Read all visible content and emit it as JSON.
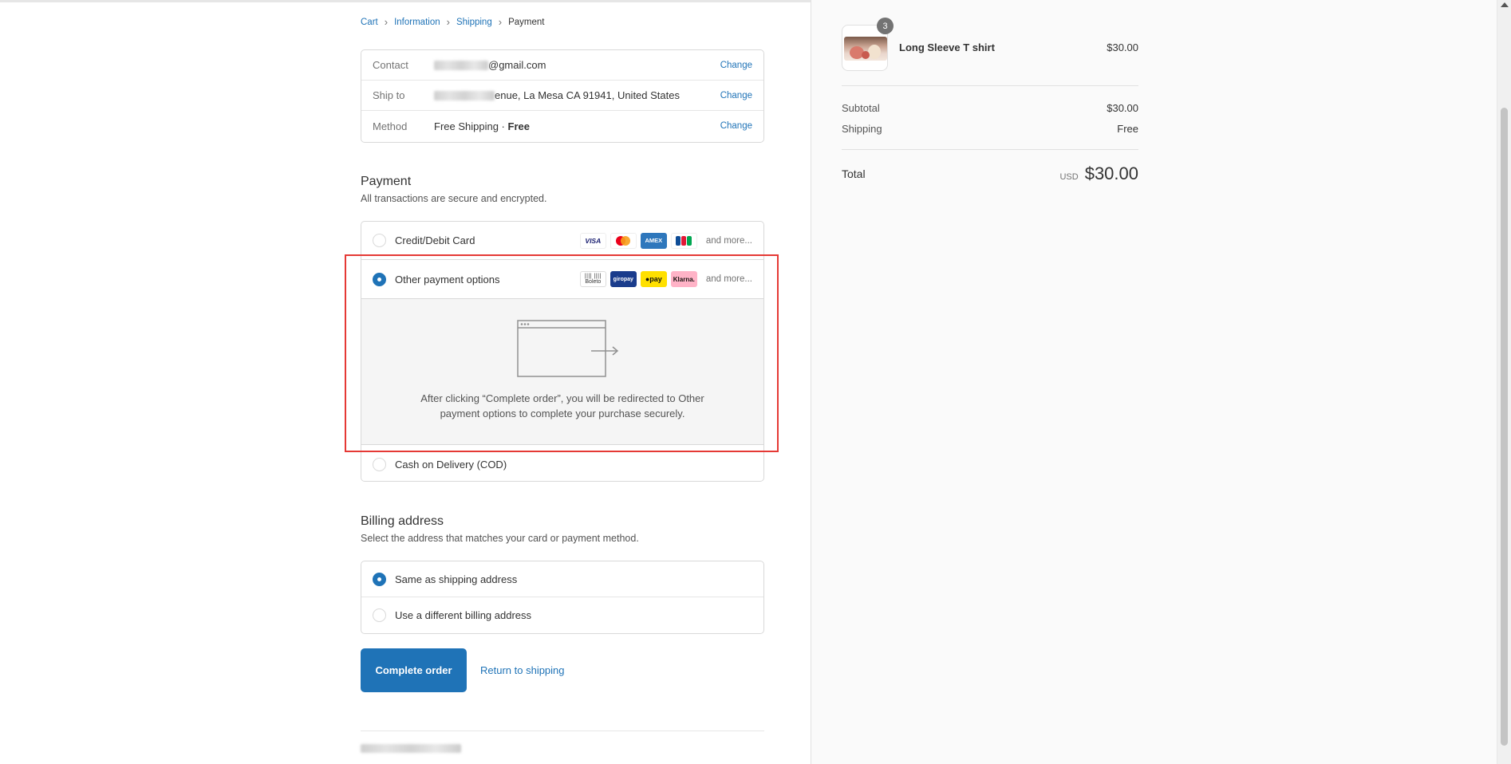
{
  "breadcrumb": {
    "items": [
      {
        "label": "Cart"
      },
      {
        "label": "Information"
      },
      {
        "label": "Shipping"
      },
      {
        "label": "Payment"
      }
    ]
  },
  "review": {
    "contact": {
      "label": "Contact",
      "value_visible": "@gmail.com",
      "change": "Change"
    },
    "ship_to": {
      "label": "Ship to",
      "value_visible": "enue, La Mesa CA 91941, United States",
      "change": "Change"
    },
    "method": {
      "label": "Method",
      "value_prefix": "Free Shipping · ",
      "value_bold": "Free",
      "change": "Change"
    }
  },
  "payment": {
    "title": "Payment",
    "subtitle": "All transactions are secure and encrypted.",
    "options": [
      {
        "label": "Credit/Debit Card",
        "selected": false,
        "icons": [
          "VISA",
          "mastercard",
          "AMEX",
          "JCB"
        ],
        "more": "and more..."
      },
      {
        "label": "Other payment options",
        "selected": true,
        "icons": [
          "Boleto",
          "giropay",
          "pay",
          "Klarna."
        ],
        "more": "and more..."
      },
      {
        "label": "Cash on Delivery (COD)",
        "selected": false
      }
    ],
    "redirect_text": "After clicking “Complete order”, you will be redirected to Other payment options to complete your purchase securely."
  },
  "billing": {
    "title": "Billing address",
    "subtitle": "Select the address that matches your card or payment method.",
    "options": [
      {
        "label": "Same as shipping address",
        "selected": true
      },
      {
        "label": "Use a different billing address",
        "selected": false
      }
    ]
  },
  "actions": {
    "complete": "Complete order",
    "return": "Return to shipping"
  },
  "summary": {
    "product": {
      "name": "Long Sleeve T shirt",
      "price": "$30.00",
      "quantity": "3"
    },
    "subtotal_label": "Subtotal",
    "subtotal_value": "$30.00",
    "shipping_label": "Shipping",
    "shipping_value": "Free",
    "total_label": "Total",
    "currency": "USD",
    "total_value": "$30.00"
  },
  "colors": {
    "accent": "#1f73b7",
    "highlight": "#e53935"
  }
}
